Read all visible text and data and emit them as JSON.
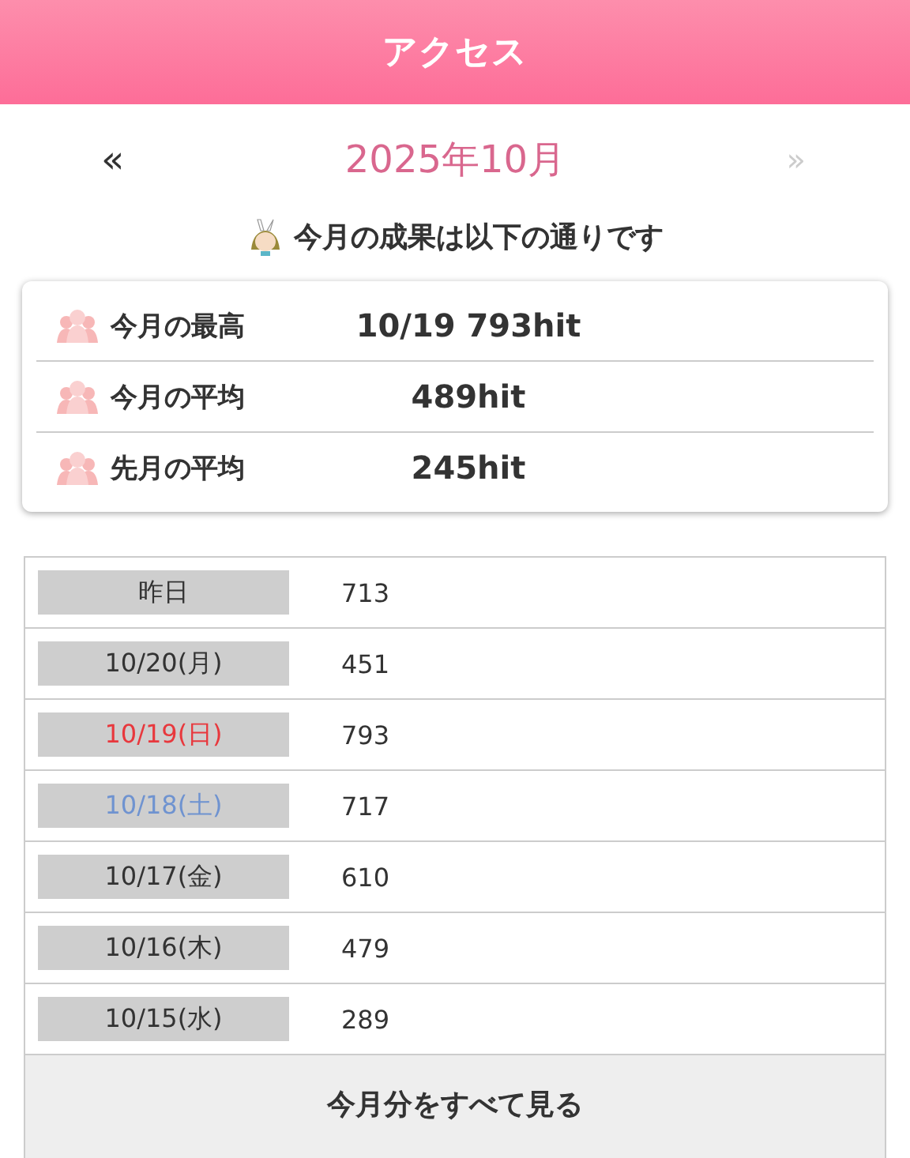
{
  "header": {
    "title": "アクセス"
  },
  "month_nav": {
    "prev": "«",
    "month": "2025年10月",
    "next": "»",
    "next_disabled": true
  },
  "intro": "今月の成果は以下の通りです",
  "summary": [
    {
      "label": "今月の最高",
      "value": "10/19 793hit"
    },
    {
      "label": "今月の平均",
      "value": "489hit"
    },
    {
      "label": "先月の平均",
      "value": "245hit"
    }
  ],
  "daily": [
    {
      "date": "昨日",
      "hits": "713",
      "color": "#333333"
    },
    {
      "date": "10/20(月)",
      "hits": "451",
      "color": "#333333"
    },
    {
      "date": "10/19(日)",
      "hits": "793",
      "color": "#e8383d"
    },
    {
      "date": "10/18(土)",
      "hits": "717",
      "color": "#6f93d0"
    },
    {
      "date": "10/17(金)",
      "hits": "610",
      "color": "#333333"
    },
    {
      "date": "10/16(木)",
      "hits": "479",
      "color": "#333333"
    },
    {
      "date": "10/15(水)",
      "hits": "289",
      "color": "#333333"
    }
  ],
  "see_all": "今月分をすべて見る"
}
